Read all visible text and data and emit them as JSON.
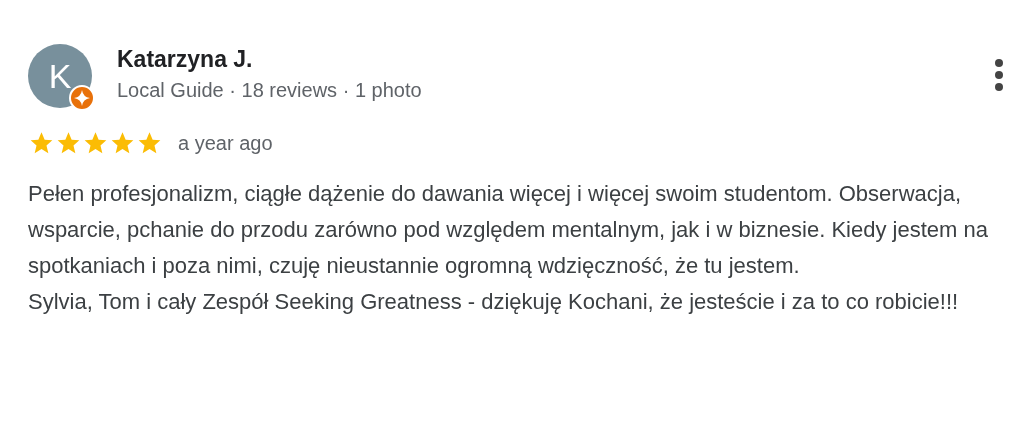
{
  "review": {
    "avatar_initial": "K",
    "author": "Katarzyna J.",
    "meta": "Local Guide · 18 reviews · 1 photo",
    "stars": 5,
    "time": "a year ago",
    "paragraphs": [
      "Pełen profesjonalizm, ciągłe dążenie do dawania więcej i więcej swoim studentom. Obserwacja, wsparcie, pchanie do przodu zarówno pod względem mentalnym, jak i w biznesie. Kiedy jestem na spotkaniach i poza nimi, czuję nieustannie ogromną wdzięczność, że tu jestem.",
      "Sylvia, Tom i cały Zespół Seeking Greatness - dziękuję Kochani, że jesteście i za to co robicie!!!"
    ]
  }
}
